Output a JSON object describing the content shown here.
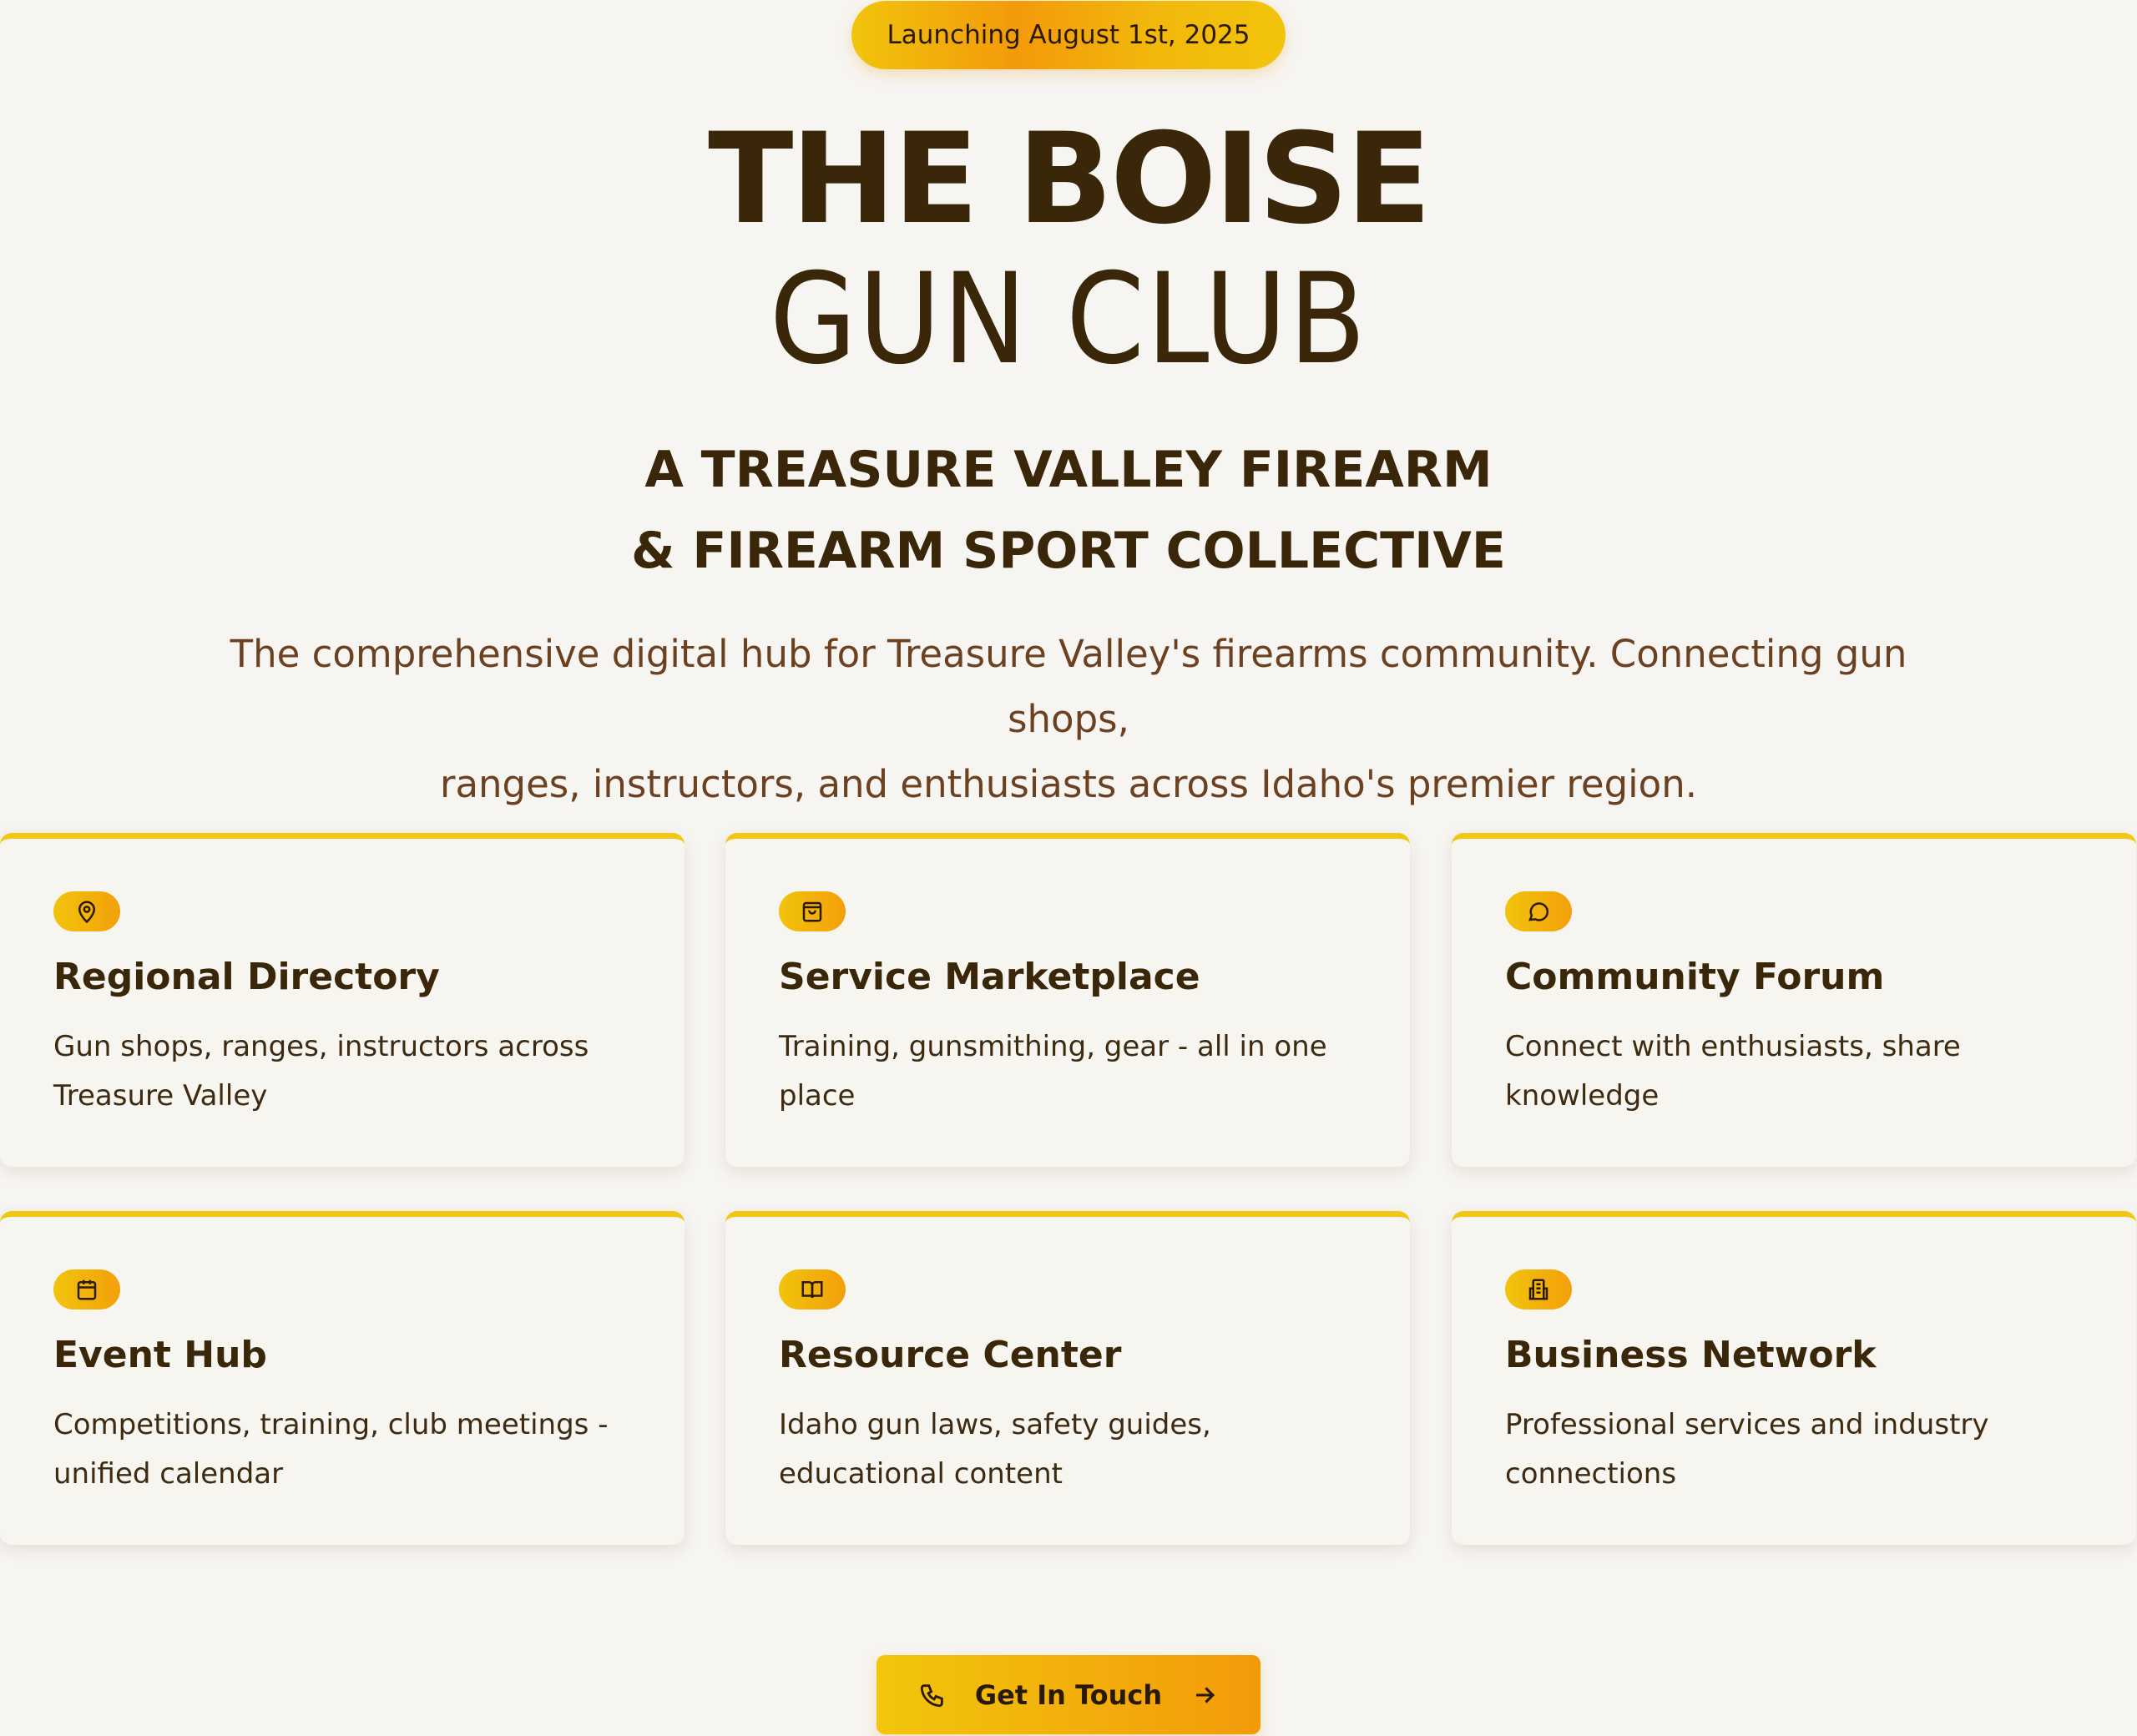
{
  "launch_badge": "Launching August 1st, 2025",
  "hero": {
    "title_line1": "THE BOISE",
    "title_line2": "GUN CLUB",
    "tagline_line1": "A TREASURE VALLEY FIREARM",
    "tagline_line2": "& FIREARM SPORT COLLECTIVE",
    "description_line1": "The comprehensive digital hub for Treasure Valley's firearms community. Connecting gun shops,",
    "description_line2": "ranges, instructors, and enthusiasts across Idaho's premier region."
  },
  "features": [
    {
      "icon": "map-pin-icon",
      "title": "Regional Directory",
      "text": "Gun shops, ranges, instructors across Treasure Valley"
    },
    {
      "icon": "shopping-bag-icon",
      "title": "Service Marketplace",
      "text": "Training, gunsmithing, gear - all in one place"
    },
    {
      "icon": "chat-bubble-icon",
      "title": "Community Forum",
      "text": "Connect with enthusiasts, share knowledge"
    },
    {
      "icon": "calendar-icon",
      "title": "Event Hub",
      "text": "Competitions, training, club meetings - unified calendar"
    },
    {
      "icon": "book-icon",
      "title": "Resource Center",
      "text": "Idaho gun laws, safety guides, educational content"
    },
    {
      "icon": "building-icon",
      "title": "Business Network",
      "text": "Professional services and industry connections"
    }
  ],
  "cta": {
    "label": "Get In Touch",
    "icon_left": "phone-icon",
    "icon_right": "arrow-right-icon"
  },
  "colors": {
    "background": "#f7f5f1",
    "accent_yellow": "#f2c40c",
    "accent_orange": "#f39a0a",
    "text_dark": "#3a2608",
    "text_brown": "#6b4121"
  }
}
